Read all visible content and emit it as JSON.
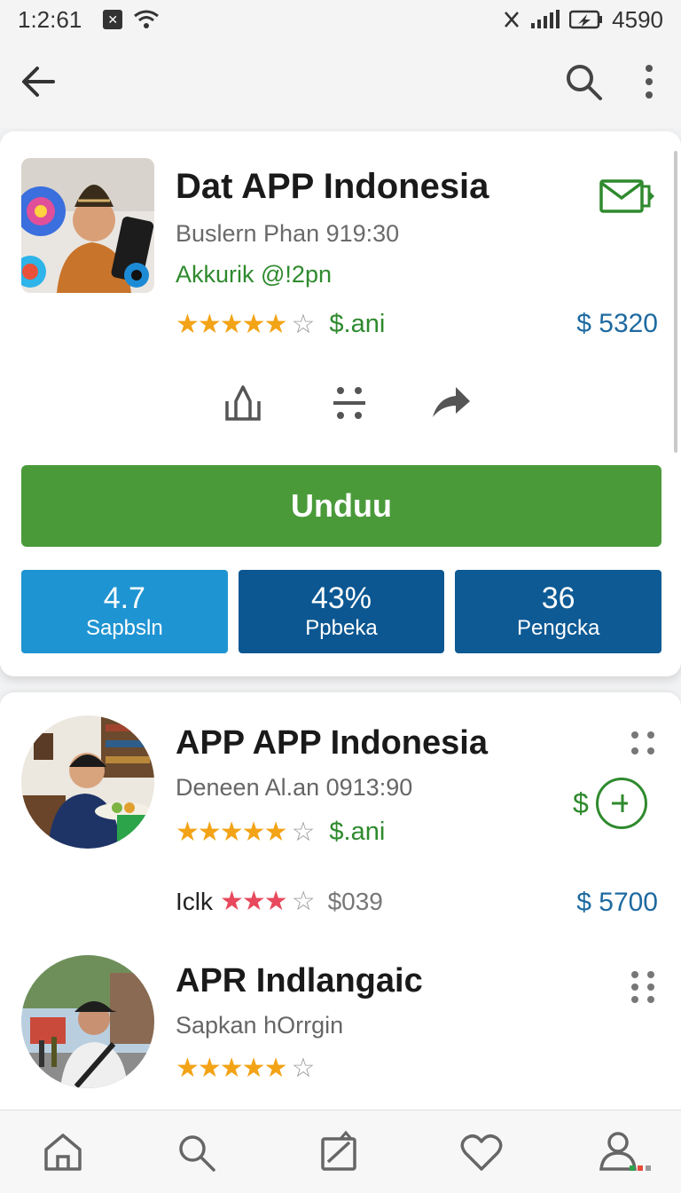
{
  "status_bar": {
    "time": "1:2:61",
    "battery": "4590"
  },
  "app_bar": {
    "back_icon": "arrow-left-icon",
    "search_icon": "search-icon",
    "more_icon": "more-vertical-icon"
  },
  "app": {
    "title": "Dat APP Indonesia",
    "subtitle": "Buslern Phan 919:30",
    "developer": "Akkurik @!2pn",
    "stars": "★★★★★",
    "star_empty": "☆",
    "price_tag": "$.ani",
    "price": "$ 5320",
    "download_label": "Unduu",
    "accent_color": "#4a9a3a",
    "stats": [
      {
        "value": "4.7",
        "label": "Sapbsln"
      },
      {
        "value": "43%",
        "label": "Ppbeka"
      },
      {
        "value": "36",
        "label": "Pengcka"
      }
    ]
  },
  "list": [
    {
      "title": "APP APP Indonesia",
      "subtitle": "Deneen Al.an 0913:90",
      "stars": "★★★★★",
      "star_empty": "☆",
      "price_tag": "$.ani",
      "plus_dollar": "$",
      "sub_label": "Iclk",
      "sub_stars": "★★★",
      "sub_star_empty": "☆",
      "sub_price": "$039",
      "price": "$ 5700"
    },
    {
      "title": "APR Indlangaic",
      "subtitle": "Sapkan hOrrgin",
      "stars": "★★★★★",
      "star_empty": "☆"
    }
  ],
  "bottom_nav": [
    "home-icon",
    "search-icon",
    "apps-icon",
    "heart-icon",
    "profile-icon"
  ]
}
